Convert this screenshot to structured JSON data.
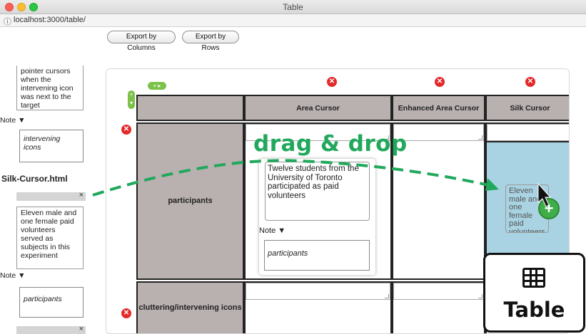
{
  "window": {
    "title": "Table",
    "url": "localhost:3000/table/"
  },
  "toolbar": {
    "export_columns": "Export by Columns",
    "export_rows": "Export by Rows"
  },
  "sidebar": {
    "card_top_text": "pointer cursors when the intervening icon was next to the target",
    "note1_label": "Note ▼",
    "note1_text": "intervening icons",
    "file_title": "Silk-Cursor.html",
    "card2_text": "Eleven male and one female paid volunteers served as subjects in this experiment",
    "note2_label": "Note ▼",
    "note2_text": "participants",
    "close_glyph": "×"
  },
  "table": {
    "columns": [
      "Area Cursor",
      "Enhanced Area Cursor",
      "Silk Cursor"
    ],
    "rows": [
      "participants",
      "cluttering/intervening icons"
    ],
    "inner_card_text": "Twelve students from the University of Toronto participated as paid volunteers",
    "inner_note_label": "Note ▼",
    "inner_note_text": "participants",
    "dropped_text": "Eleven male and one female paid volunteers",
    "delete_glyph": "✕",
    "add_glyph": "+"
  },
  "overlay": {
    "drag_label": "drag & drop",
    "logo_text": "Table"
  },
  "colors": {
    "drag_green": "#21a85c",
    "cell_gray": "#b9b0b0",
    "drop_blue": "#a9d3e2",
    "delete_red": "#e32929"
  }
}
